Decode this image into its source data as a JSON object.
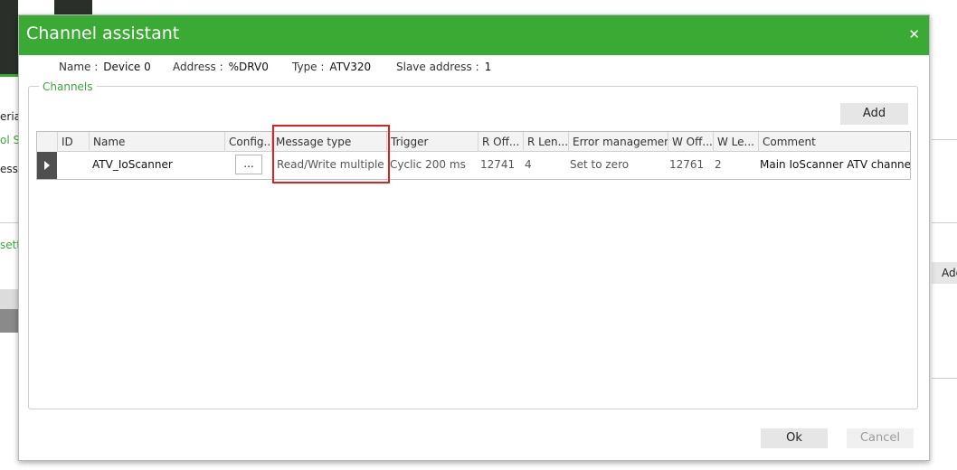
{
  "background": {
    "fragments": [
      "eria",
      "ol Se",
      "essio",
      "sett"
    ],
    "right_button_label": "Add"
  },
  "dialog": {
    "title": "Channel assistant",
    "close_glyph": "✕",
    "info": {
      "name_label": "Name :",
      "name_value": "Device 0",
      "address_label": "Address :",
      "address_value": "%DRV0",
      "type_label": "Type :",
      "type_value": "ATV320",
      "slave_label": "Slave address :",
      "slave_value": "1"
    },
    "group_label": "Channels",
    "add_label": "Add",
    "ok_label": "Ok",
    "cancel_label": "Cancel",
    "table": {
      "columns": [
        "ID",
        "Name",
        "Config...",
        "Message type",
        "Trigger",
        "R Off...",
        "R Len...",
        "Error management",
        "W Off...",
        "W Le...",
        "Comment"
      ],
      "rows": [
        {
          "id": "",
          "name": "ATV_IoScanner",
          "config": "...",
          "message_type": "Read/Write multiple words",
          "trigger": "Cyclic 200 ms",
          "r_offset": "12741",
          "r_length": "4",
          "error_management": "Set to zero",
          "w_offset": "12761",
          "w_length": "2",
          "comment": "Main IoScanner ATV channel"
        }
      ]
    }
  },
  "colors": {
    "accent": "#3aaa35",
    "highlight": "#e02020",
    "row_header": "#4f4f4f"
  }
}
